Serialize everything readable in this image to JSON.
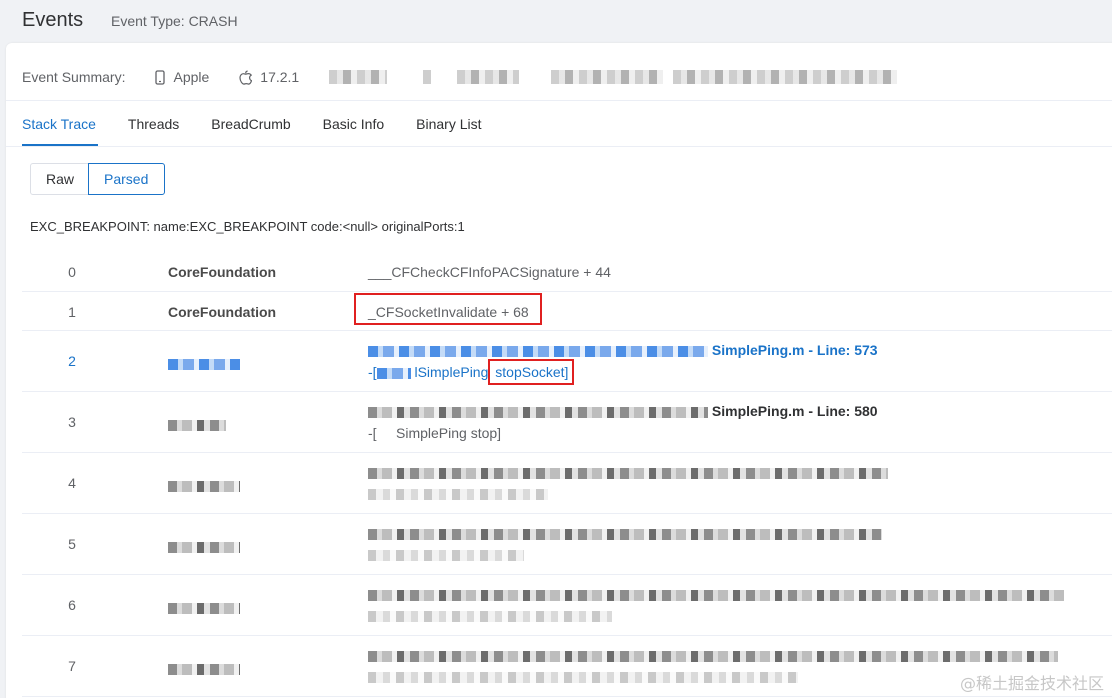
{
  "header": {
    "title": "Events",
    "event_type": "Event Type: CRASH"
  },
  "summary": {
    "label": "Event Summary:",
    "device": "Apple",
    "os_version": "17.2.1"
  },
  "tabs": [
    {
      "label": "Stack Trace",
      "active": true
    },
    {
      "label": "Threads",
      "active": false
    },
    {
      "label": "BreadCrumb",
      "active": false
    },
    {
      "label": "Basic Info",
      "active": false
    },
    {
      "label": "Binary List",
      "active": false
    }
  ],
  "view_toggle": {
    "raw": "Raw",
    "parsed": "Parsed",
    "selected": "Parsed"
  },
  "exception": "EXC_BREAKPOINT: name:EXC_BREAKPOINT code:<null> originalPorts:1",
  "frames": [
    {
      "index": "0",
      "library": "CoreFoundation",
      "symbol": "___CFCheckCFInfoPACSignature + 44"
    },
    {
      "index": "1",
      "library": "CoreFoundation",
      "symbol": "_CFSocketInvalidate + 68"
    },
    {
      "index": "2",
      "file_line": "SimplePing.m - Line: 573",
      "method_prefix": "-[",
      "method_class": "lSimplePing",
      "method_name": "stopSocket]"
    },
    {
      "index": "3",
      "file_line": "SimplePing.m - Line: 580",
      "method": "-[     SimplePing stop]"
    },
    {
      "index": "4"
    },
    {
      "index": "5"
    },
    {
      "index": "6"
    },
    {
      "index": "7"
    }
  ],
  "colors": {
    "accent": "#1a73c8",
    "highlight": "#e02020"
  },
  "watermark": "@稀土掘金技术社区"
}
